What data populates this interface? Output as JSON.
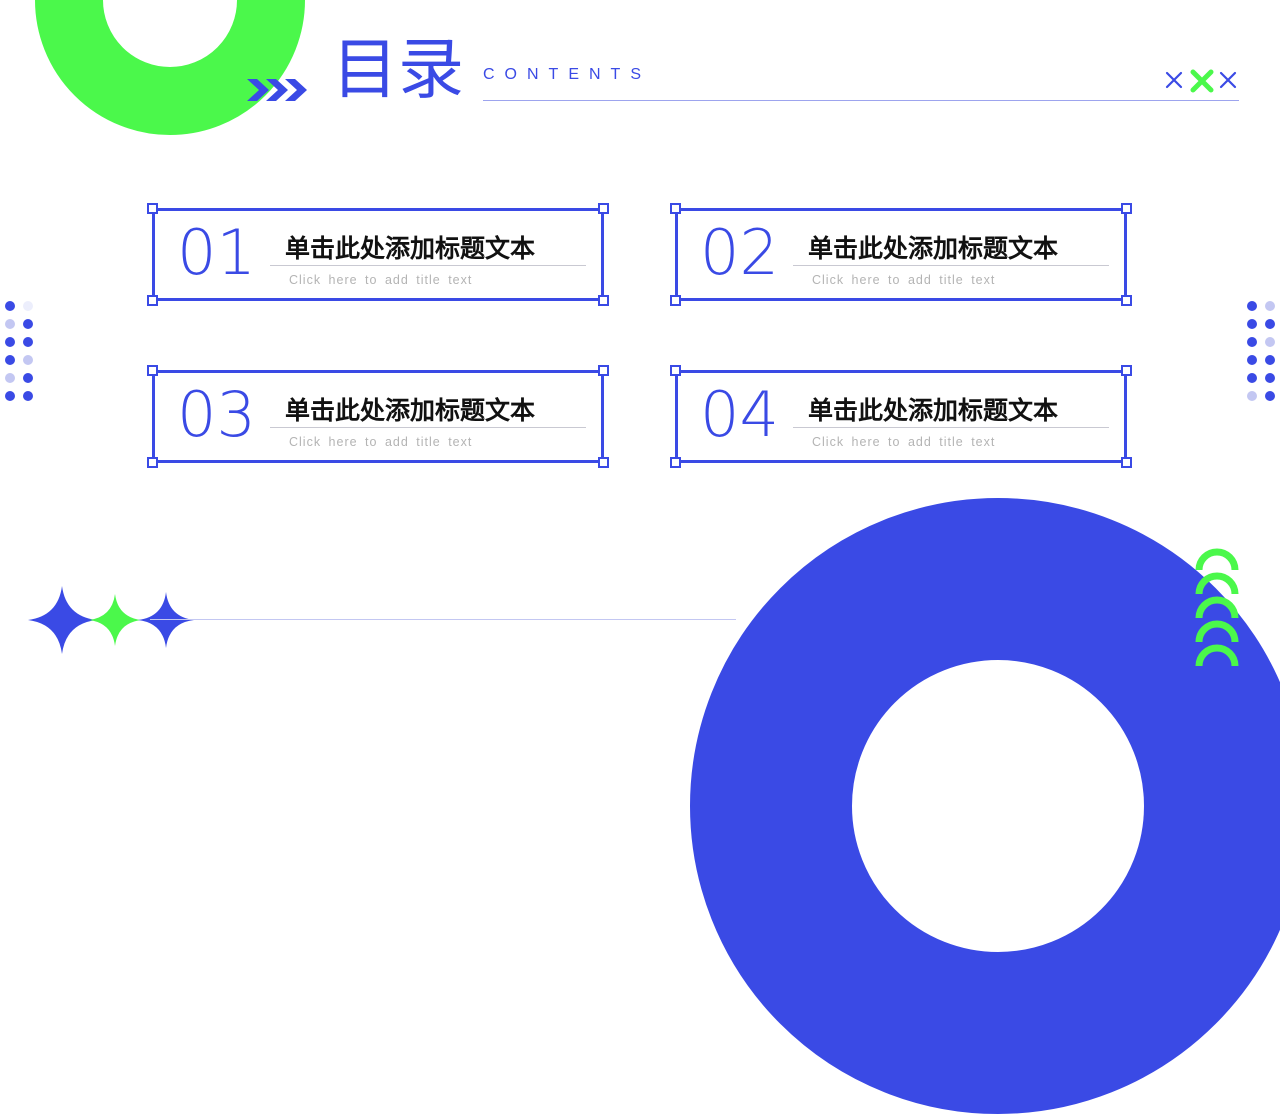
{
  "header": {
    "title": "目录",
    "subtitle": "CONTENTS"
  },
  "colors": {
    "accent_blue": "#3a4ae5",
    "accent_green": "#4bf84b",
    "light_blue": "#c3c7f2"
  },
  "items": [
    {
      "number": "01",
      "title": "单击此处添加标题文本",
      "subtitle": "Click here to add title text"
    },
    {
      "number": "02",
      "title": "单击此处添加标题文本",
      "subtitle": "Click here to add title text"
    },
    {
      "number": "03",
      "title": "单击此处添加标题文本",
      "subtitle": "Click here to add title text"
    },
    {
      "number": "04",
      "title": "单击此处添加标题文本",
      "subtitle": "Click here to add title text"
    }
  ],
  "decor_icons": [
    "green-ring",
    "blue-ring",
    "chevron-arrows-icon",
    "cross-marks-icon",
    "sparkle-stars-icon",
    "dot-grid-left",
    "dot-grid-right",
    "stacked-arcs-icon"
  ]
}
